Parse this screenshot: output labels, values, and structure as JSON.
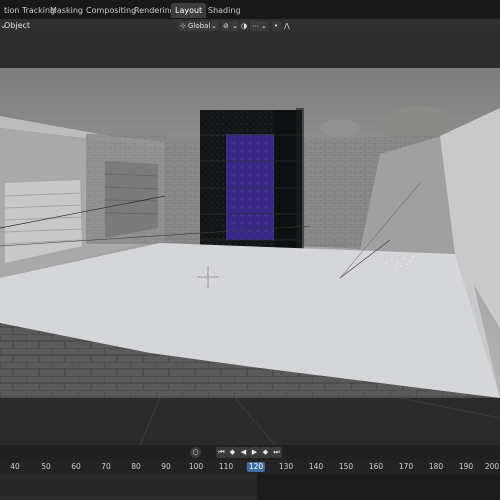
{
  "workspace_tabs": [
    "tion Tracking",
    "Masking",
    "Compositing",
    "Rendering",
    "Layout",
    "Shading"
  ],
  "active_tab": "Layout",
  "header": {
    "object_menu": "Object",
    "orientation": "Global",
    "orientation_icon": "chevron-down-icon",
    "snap_icon": "magnet-icon",
    "proportional_icon": "falloff-icon"
  },
  "playback": {
    "buttons": [
      "⏮",
      "◆",
      "◀",
      "▶",
      "◆",
      "⏭"
    ]
  },
  "timeline": {
    "ticks": [
      "40",
      "50",
      "60",
      "70",
      "80",
      "90",
      "100",
      "110",
      "120",
      "130",
      "140",
      "150",
      "160",
      "170",
      "180",
      "190",
      "200"
    ],
    "current_frame": "120"
  },
  "colors": {
    "active_tab_bg": "#3d3d3d",
    "current_frame_bg": "#3f6ea3",
    "portal_inner": "#3a2a86",
    "portal_frame": "#111414"
  }
}
